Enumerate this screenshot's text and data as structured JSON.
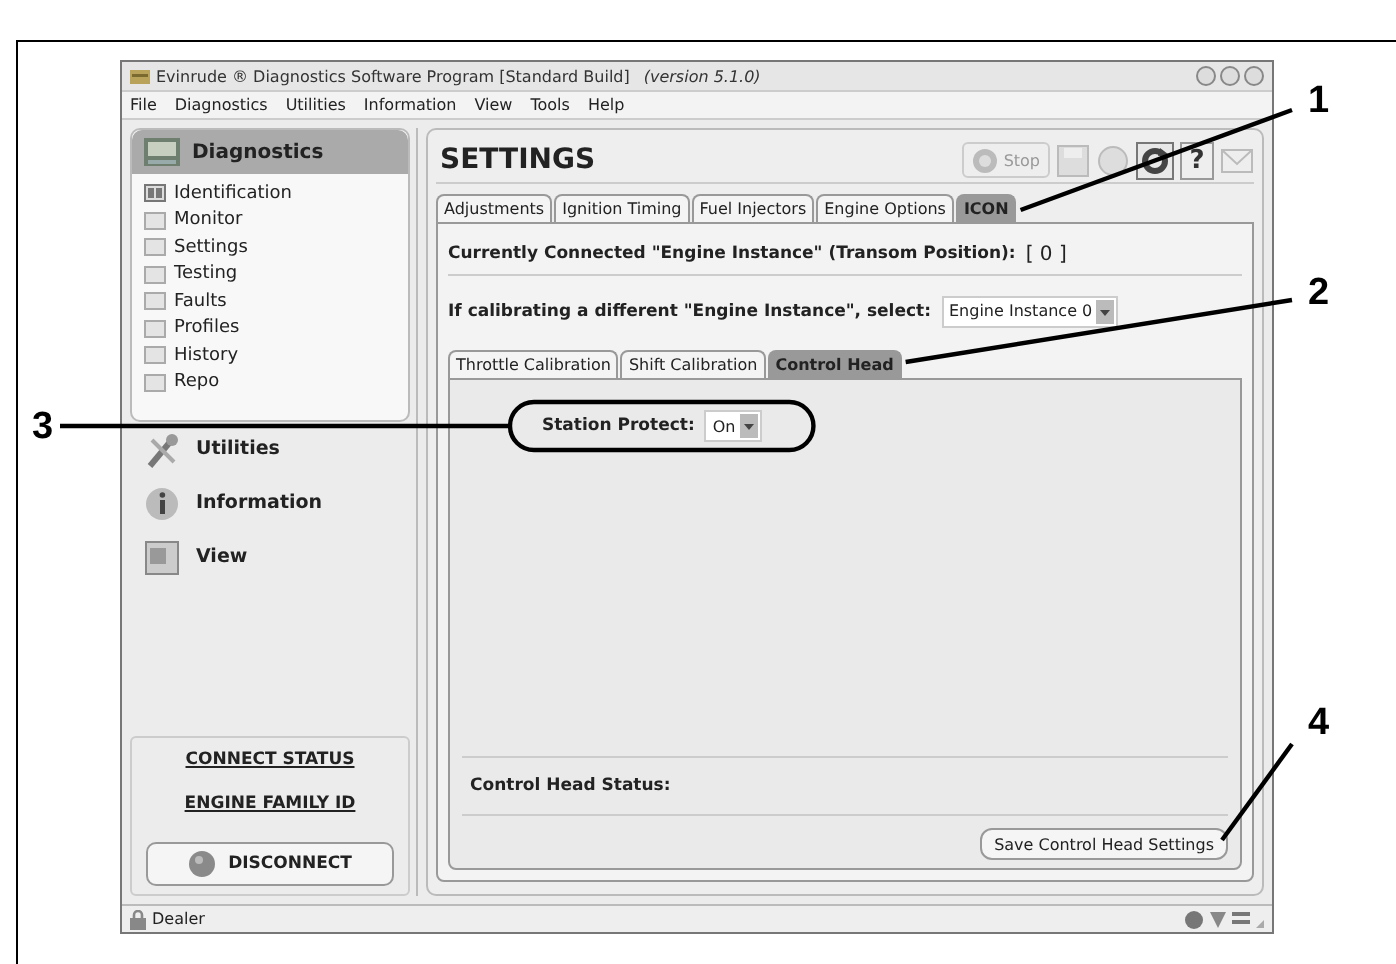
{
  "window": {
    "title": "Evinrude ® Diagnostics Software Program [Standard Build]",
    "version": "(version 5.1.0)"
  },
  "menu": [
    "File",
    "Diagnostics",
    "Utilities",
    "Information",
    "View",
    "Tools",
    "Help"
  ],
  "sidebar": {
    "header": "Diagnostics",
    "items": [
      {
        "label": "Identification",
        "kind": "id"
      },
      {
        "label": "Monitor",
        "kind": "page"
      },
      {
        "label": "Settings",
        "kind": "page"
      },
      {
        "label": "Testing",
        "kind": "page"
      },
      {
        "label": "Faults",
        "kind": "page"
      },
      {
        "label": "Profiles",
        "kind": "page"
      },
      {
        "label": "History",
        "kind": "page"
      },
      {
        "label": "Repo",
        "kind": "page"
      }
    ],
    "sections": [
      {
        "label": "Utilities",
        "kind": "tools"
      },
      {
        "label": "Information",
        "kind": "info"
      },
      {
        "label": "View",
        "kind": "view"
      }
    ],
    "connect_status": "CONNECT STATUS",
    "engine_family": "ENGINE FAMILY ID",
    "disconnect": "DISCONNECT"
  },
  "page_title": "SETTINGS",
  "stop_button": "Stop",
  "help_button": "?",
  "tabs": [
    {
      "label": "Adjustments",
      "selected": false
    },
    {
      "label": "Ignition Timing",
      "selected": false
    },
    {
      "label": "Fuel Injectors",
      "selected": false
    },
    {
      "label": "Engine Options",
      "selected": false
    },
    {
      "label": "ICON",
      "selected": true
    }
  ],
  "connected": {
    "label": "Currently Connected \"Engine Instance\" (Transom Position):",
    "value": "[ 0 ]"
  },
  "instance_select": {
    "label": "If calibrating a different \"Engine Instance\", select:",
    "value": "Engine Instance 0"
  },
  "subtabs": [
    {
      "label": "Throttle Calibration",
      "selected": false
    },
    {
      "label": "Shift Calibration",
      "selected": false
    },
    {
      "label": "Control Head",
      "selected": true
    }
  ],
  "station_protect": {
    "label": "Station Protect:",
    "value": "On"
  },
  "status_label": "Control Head Status:",
  "save_button": "Save Control Head Settings",
  "status_bar": {
    "user": "Dealer"
  },
  "callouts": [
    "1",
    "2",
    "3",
    "4"
  ]
}
